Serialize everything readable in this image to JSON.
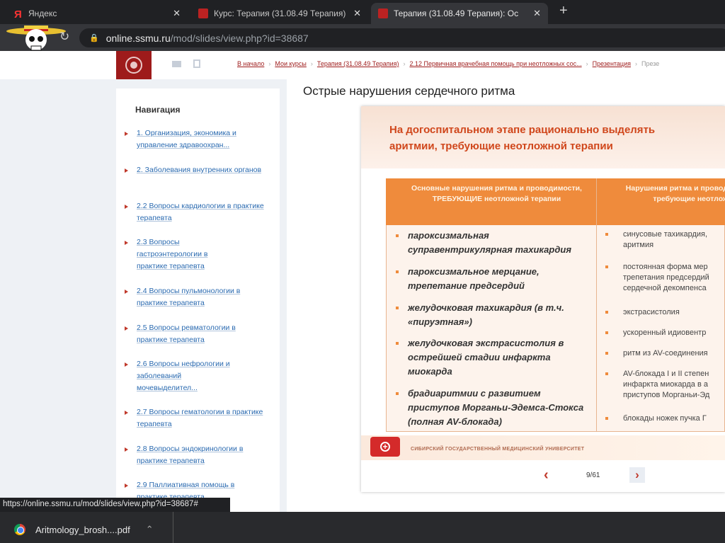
{
  "tabs": [
    {
      "title": "Яндекс",
      "icon": "yandex-icon"
    },
    {
      "title": "Курс: Терапия (31.08.49 Терапия)",
      "icon": "ssmu-icon"
    },
    {
      "title": "Терапия (31.08.49 Терапия): Ос",
      "icon": "ssmu-icon",
      "active": true
    }
  ],
  "address": {
    "host": "online.ssmu.ru",
    "path": "/mod/slides/view.php?id=38687"
  },
  "breadcrumbs": [
    "В начало",
    "Мои курсы",
    "Терапия (31.08.49 Терапия)",
    "2.12 Первичная врачебная помощь при неотложных сос...",
    "Презентация",
    "Презе"
  ],
  "nav": {
    "title": "Навигация",
    "items": [
      "1. Организация, экономика и управление здравоохран...",
      "2. Заболевания внутренних органов",
      "2.2 Вопросы кардиологии в практике терапевта",
      "2.3 Вопросы гастроэнтерологии в практике терапевта",
      "2.4 Вопросы пульмонологии в практике терапевта",
      "2.5 Вопросы ревматологии в практике терапевта",
      "2.6 Вопросы нефрологии и заболеваний мочевыделител...",
      "2.7 Вопросы гематологии в практике терапевта",
      "2.8 Вопросы эндокринологии в практике терапевта",
      "2.9 Паллиативная помощь в практике терапевта"
    ]
  },
  "page_title": "Острые нарушения сердечного ритма",
  "slide": {
    "title": "На догоспитальном этапе рационально выделять аритмии, требующие неотложной терапии",
    "col1_header": "Основные нарушения ритма и проводимости, ТРЕБУЮЩИЕ неотложной терапии",
    "col2_header": "Нарушения ритма и проводимости, НЕ требующие неотложной",
    "col1": [
      "пароксизмальная суправентрикулярная тахикардия",
      "пароксизмальное мерцание, трепетание предсердий",
      "желудочковая тахикардия (в т.ч. «пируэтная»)",
      "желудочковая экстрасистолия в острейшей стадии инфаркта миокарда",
      "брадиаритмии с развитием приступов Морганьи-Эдемса-Стокса (полная AV-блокада)"
    ],
    "col2": [
      "синусовые тахикардия,\nаритмия",
      "постоянная форма мер\nтрепетания предсердий\nсердечной декомпенса",
      "экстрасистолия",
      "ускоренный идиовентр",
      "ритм из AV-соединения",
      "AV-блокада I и II степен\nинфаркта миокарда в а\nприступов Морганьи-Эд",
      "блокады ножек пучка Г"
    ],
    "footer": "СИБИРСКИЙ ГОСУДАРСТВЕННЫЙ МЕДИЦИНСКИЙ УНИВЕРСИТЕТ"
  },
  "pager": {
    "label": "9/61",
    "current": 9,
    "total": 61
  },
  "status_url": "https://online.ssmu.ru/mod/slides/view.php?id=38687#",
  "download": {
    "file": "Aritmology_brosh....pdf"
  }
}
